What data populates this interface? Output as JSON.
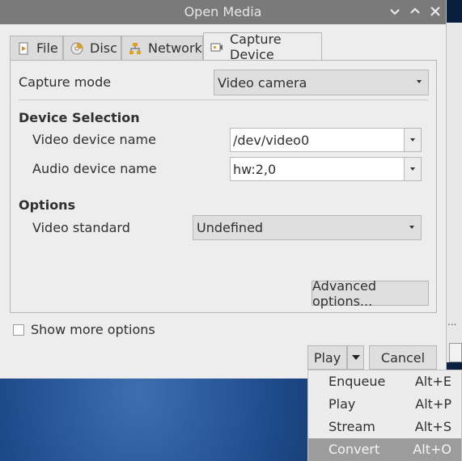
{
  "window": {
    "title": "Open Media"
  },
  "tabs": [
    {
      "label": "File",
      "icon": "file-icon"
    },
    {
      "label": "Disc",
      "icon": "disc-icon"
    },
    {
      "label": "Network",
      "icon": "network-icon"
    },
    {
      "label": "Capture Device",
      "icon": "capture-device-icon"
    }
  ],
  "capture": {
    "mode_label": "Capture mode",
    "mode_value": "Video camera",
    "device_selection_heading": "Device Selection",
    "video_device_label": "Video device name",
    "video_device_value": "/dev/video0",
    "audio_device_label": "Audio device name",
    "audio_device_value": "hw:2,0",
    "options_heading": "Options",
    "video_standard_label": "Video standard",
    "video_standard_value": "Undefined",
    "advanced_button": "Advanced options..."
  },
  "footer": {
    "show_more_label": "Show more options",
    "play_button": "Play",
    "cancel_button": "Cancel"
  },
  "play_menu": [
    {
      "label": "Enqueue",
      "shortcut": "Alt+E"
    },
    {
      "label": "Play",
      "shortcut": "Alt+P"
    },
    {
      "label": "Stream",
      "shortcut": "Alt+S"
    },
    {
      "label": "Convert",
      "shortcut": "Alt+O"
    }
  ],
  "background_fragment": "..."
}
